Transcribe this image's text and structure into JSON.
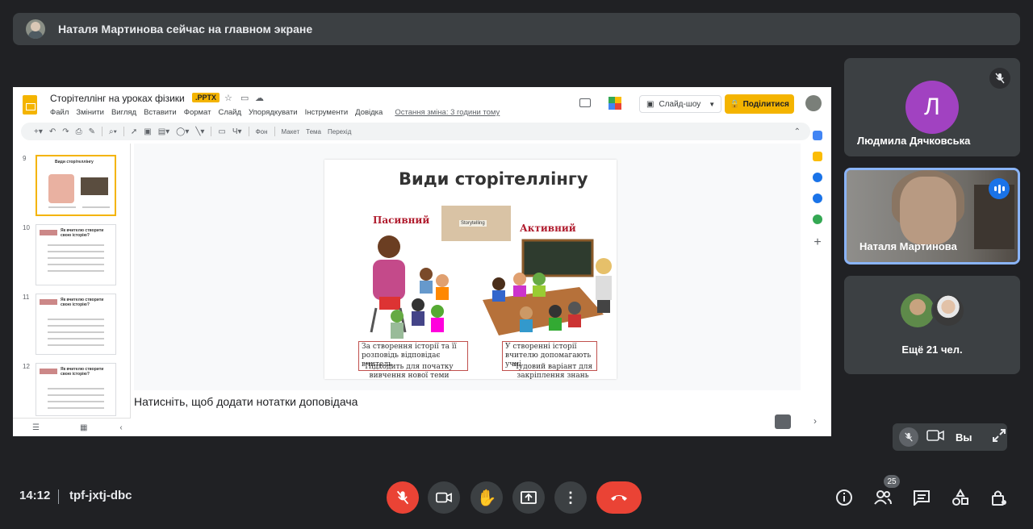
{
  "banner": {
    "text": "Наталя Мартинова сейчас на главном экране"
  },
  "slides_app": {
    "doc_title": "Сторітеллінг на уроках фізики",
    "doc_badge": ".PPTX",
    "menu": [
      "Файл",
      "Змінити",
      "Вигляд",
      "Вставити",
      "Формат",
      "Слайд",
      "Упорядкувати",
      "Інструменти",
      "Довідка"
    ],
    "last_edit": "Остання зміна: 3 години тому",
    "slideshow_label": "Слайд-шоу",
    "share_label": "Поділитися",
    "toolbar": {
      "bg": "Фон",
      "layout": "Макет",
      "theme": "Тема",
      "transition": "Перехід"
    },
    "slide_numbers": [
      "9",
      "10",
      "11",
      "12"
    ],
    "thumb_titles": [
      "Види сторітеллінгу",
      "Як вчителю створити свою історію?",
      "Як вчителю створити свою історію?",
      "Як вчителю створити свою історію?"
    ],
    "notes_placeholder": "Натисніть, щоб додати нотатки доповідача"
  },
  "slide": {
    "title": "Види сторітеллінгу",
    "passive": "Пасивний",
    "active": "Активний",
    "story_sign": "Storytelling",
    "passive_box": "За створення історії та її розповідь відповідає вчитель",
    "active_box": "У створенні історії вчителю допомагають учні",
    "passive_cap": "Підходить для початку вивчення нової теми",
    "active_cap": "Чудовий варіант для закріплення знань"
  },
  "participants": {
    "p1": {
      "initial": "Л",
      "name": "Людмила Дячковська",
      "muted": true
    },
    "p2": {
      "name": "Наталя Мартинова",
      "speaking": true
    },
    "more": "Ещё 21 чел."
  },
  "self": {
    "label": "Вы"
  },
  "meeting": {
    "time": "14:12",
    "code": "tpf-jxtj-dbc",
    "people_count": "25"
  },
  "colors": {
    "bg": "#202124",
    "tile": "#3c4043",
    "accent": "#8ab4f8",
    "red": "#ea4335",
    "slides_yellow": "#f4b400"
  }
}
